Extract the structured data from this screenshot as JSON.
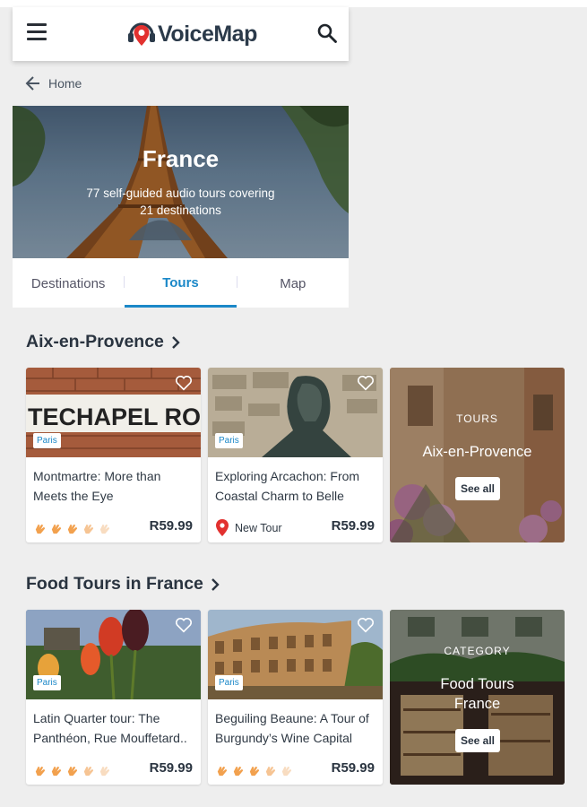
{
  "header": {
    "logo_text": "VoiceMap",
    "menu_icon": "hamburger-menu-icon",
    "search_icon": "search-icon"
  },
  "breadcrumb": {
    "label": "Home",
    "icon": "arrow-left-icon"
  },
  "hero": {
    "title": "France",
    "subtitle": "77 self-guided audio tours covering 21 destinations"
  },
  "tabs": [
    {
      "label": "Destinations",
      "active": false
    },
    {
      "label": "Tours",
      "active": true
    },
    {
      "label": "Map",
      "active": false
    }
  ],
  "sections": [
    {
      "title": "Aix-en-Provence",
      "cards": [
        {
          "badge": "Paris",
          "title": "Montmartre: More than Meets the Eye",
          "price": "R59.99",
          "rating_hands": 5,
          "rating_filled": 3
        },
        {
          "badge": "Paris",
          "title": "Exploring Arcachon: From Coastal Charm to Belle",
          "price": "R59.99",
          "status": "New Tour"
        }
      ],
      "feature": {
        "kicker": "TOURS",
        "title": "Aix-en-Provence",
        "button": "See all"
      }
    },
    {
      "title": "Food Tours in France",
      "cards": [
        {
          "badge": "Paris",
          "title": "Latin Quarter tour: The Panthéon, Rue Mouffetard..",
          "price": "R59.99",
          "rating_hands": 5,
          "rating_filled": 3
        },
        {
          "badge": "Paris",
          "title": "Beguiling Beaune: A Tour of Burgundy’s Wine Capital",
          "price": "R59.99",
          "rating_hands": 5,
          "rating_filled": 3
        }
      ],
      "feature": {
        "kicker": "CATEGORY",
        "title": "Food Tours France",
        "button": "See all"
      }
    }
  ],
  "colors": {
    "accent": "#1b88c8",
    "brand_red": "#e2312f",
    "hand": "#f2a14e"
  }
}
